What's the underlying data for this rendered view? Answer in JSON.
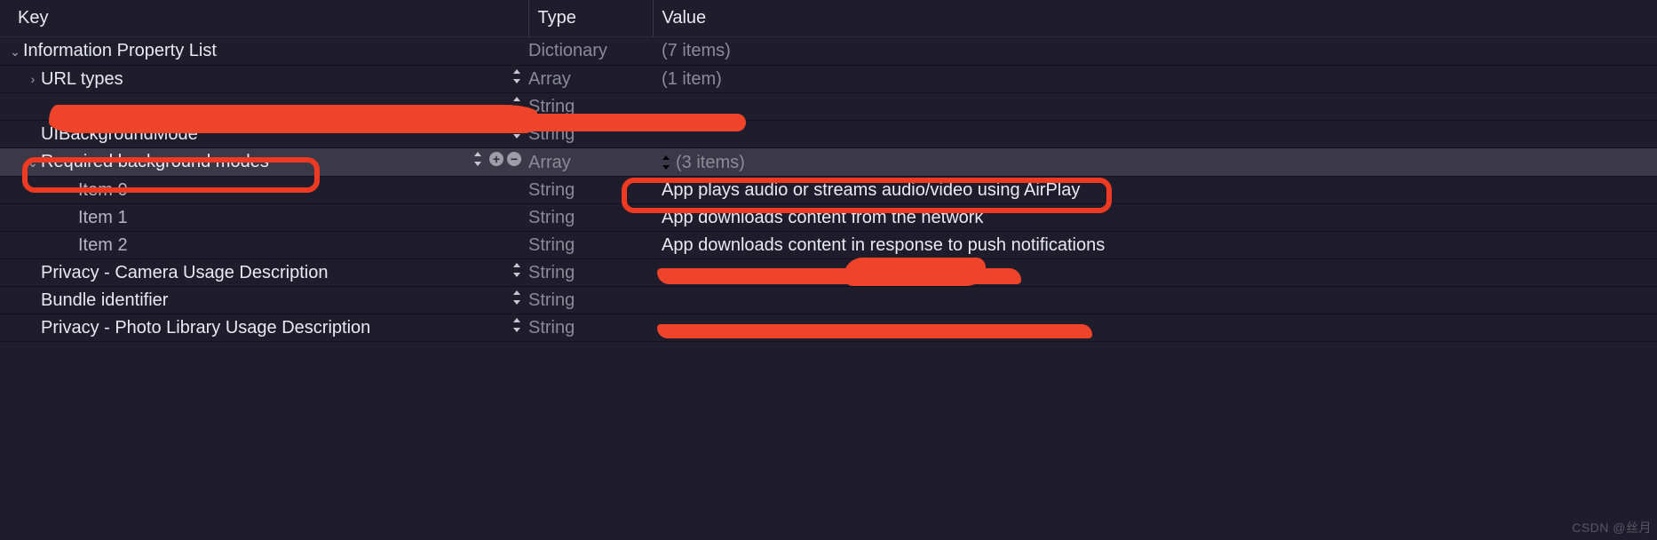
{
  "headers": {
    "key": "Key",
    "type": "Type",
    "value": "Value"
  },
  "rows": [
    {
      "indent": 0,
      "arrow": "down",
      "key": "Information Property List",
      "type": "Dictionary",
      "value": "(7 items)",
      "dimValue": true
    },
    {
      "indent": 1,
      "arrow": "right",
      "key": "URL types",
      "type": "Array",
      "value": "(1 item)",
      "dimValue": true,
      "stepper": true
    },
    {
      "indent": 1,
      "arrow": "none",
      "key": "",
      "type": "String",
      "value": "",
      "stepper": true,
      "scribbleRow": true
    },
    {
      "indent": 1,
      "arrow": "none",
      "key": "UIBackgroundMode",
      "type": "String",
      "value": "",
      "stepper": true
    },
    {
      "indent": 1,
      "arrow": "down",
      "key": "Required background modes",
      "type": "Array",
      "value": "(3 items)",
      "dimValue": true,
      "selected": true,
      "stepper": true,
      "plusminus": true,
      "valueStepper": true
    },
    {
      "indent": 3,
      "arrow": "none",
      "key": "Item 0",
      "type": "String",
      "value": "App plays audio or streams audio/video using AirPlay",
      "dimKey": true
    },
    {
      "indent": 3,
      "arrow": "none",
      "key": "Item 1",
      "type": "String",
      "value": "App downloads content from the network",
      "dimKey": true
    },
    {
      "indent": 3,
      "arrow": "none",
      "key": "Item 2",
      "type": "String",
      "value": "App downloads content in response to push notifications",
      "dimKey": true
    },
    {
      "indent": 1,
      "arrow": "none",
      "key": "Privacy - Camera Usage Description",
      "type": "String",
      "value": "",
      "stepper": true,
      "scribbleVal": true
    },
    {
      "indent": 1,
      "arrow": "none",
      "key": "Bundle identifier",
      "type": "String",
      "value": "",
      "stepper": true
    },
    {
      "indent": 1,
      "arrow": "none",
      "key": "Privacy - Photo Library Usage Description",
      "type": "String",
      "value": "",
      "stepper": true,
      "scribbleVal": true
    }
  ],
  "watermark": "CSDN @丝月"
}
